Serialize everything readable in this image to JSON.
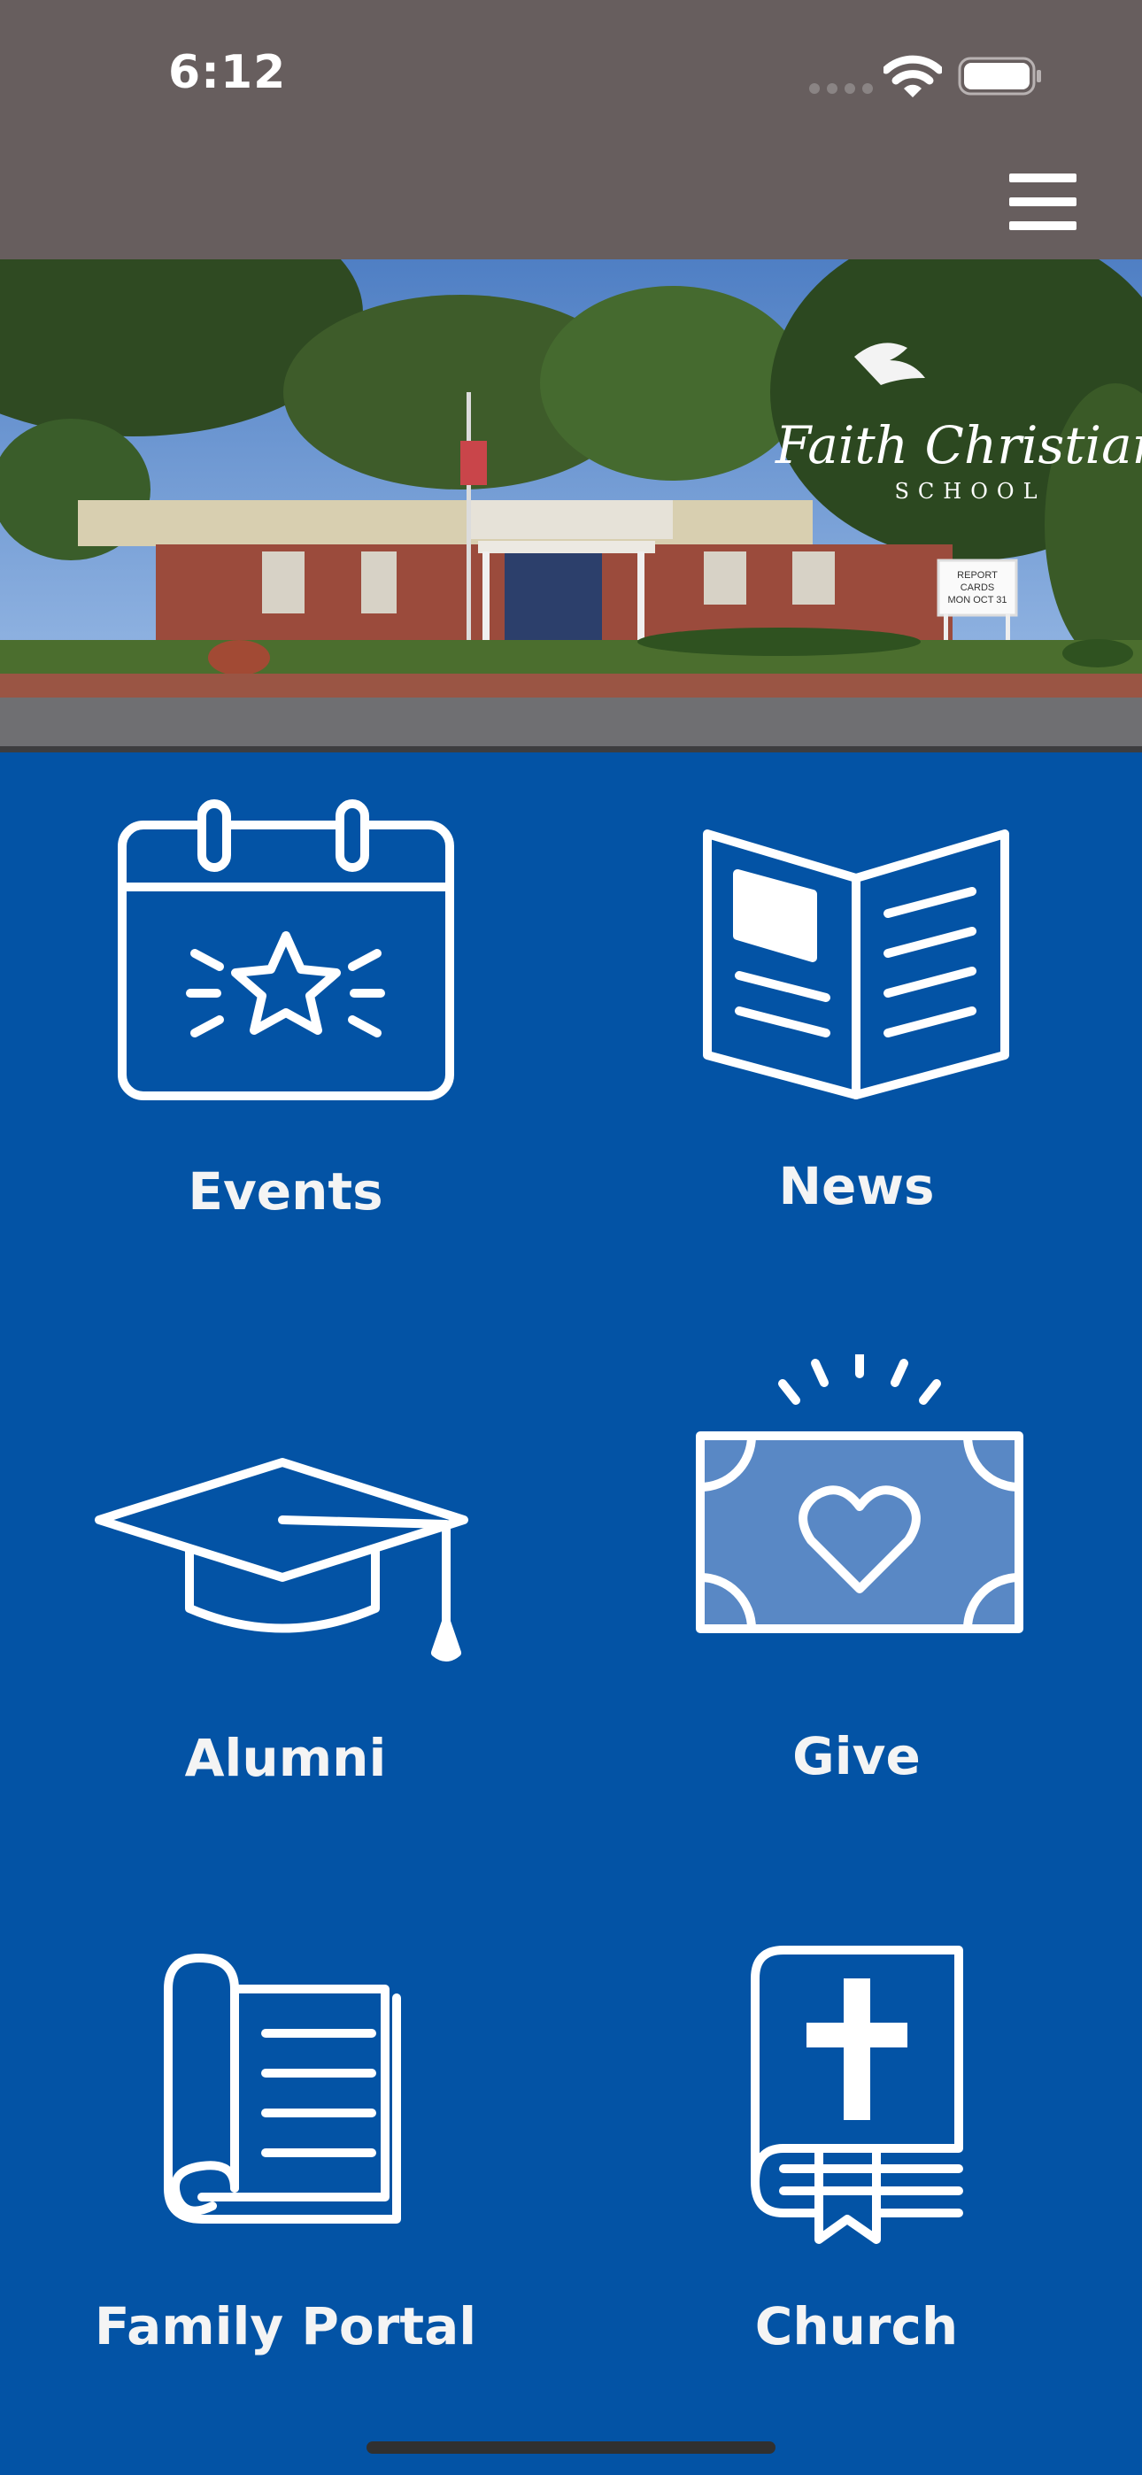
{
  "status_bar": {
    "time": "6:12"
  },
  "header": {
    "menu_icon": "hamburger-menu-icon"
  },
  "hero": {
    "logo_line1": "Faith Christian",
    "logo_line2": "SCHOOL",
    "sign_line1": "REPORT",
    "sign_line2": "CARDS",
    "sign_line3": "MON OCT 31"
  },
  "tiles": [
    {
      "label": "Events",
      "icon": "calendar-star-icon"
    },
    {
      "label": "News",
      "icon": "newspaper-icon"
    },
    {
      "label": "Alumni",
      "icon": "graduation-cap-icon"
    },
    {
      "label": "Give",
      "icon": "money-heart-icon"
    },
    {
      "label": "Family Portal",
      "icon": "open-book-icon"
    },
    {
      "label": "Church",
      "icon": "bible-cross-icon"
    }
  ],
  "colors": {
    "background": "#0353A5",
    "header": "#675E5E",
    "icon": "#FFFFFF"
  }
}
